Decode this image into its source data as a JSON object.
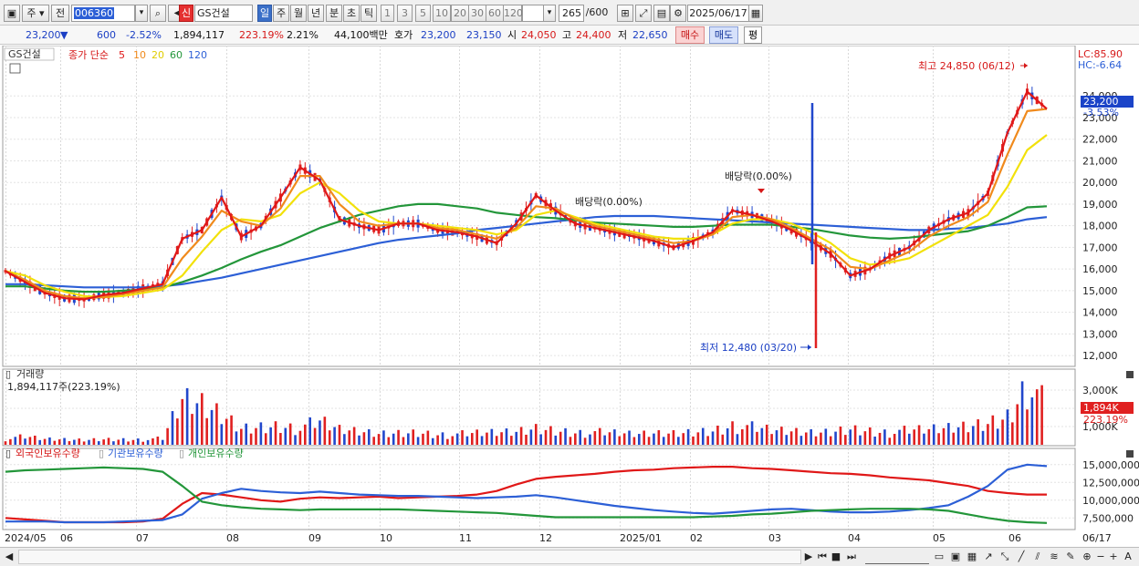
{
  "toolbar": {
    "period_unit": "주",
    "prev_label": "전",
    "stock_code": "006360",
    "new_badge": "신",
    "stock_name": "GS건설",
    "periods": [
      "일",
      "주",
      "월",
      "년",
      "분",
      "초",
      "틱"
    ],
    "minute_options": [
      "1",
      "3",
      "5",
      "10",
      "20",
      "30",
      "60",
      "120"
    ],
    "count_value": "265",
    "count_total": "/600",
    "date": "2025/06/17"
  },
  "quote": {
    "price": "23,200",
    "change_arrow": "▼",
    "change": "600",
    "change_pct": "-2.52%",
    "volume": "1,894,117",
    "volume_ratio": "223.19%",
    "turnover": "2.21%",
    "amount": "44,100백만",
    "hoga_label": "호가",
    "ask": "23,200",
    "bid": "23,150",
    "open_label": "시",
    "open": "24,050",
    "high_label": "고",
    "high": "24,400",
    "low_label": "저",
    "low": "22,650",
    "buy_label": "매수",
    "sell_label": "매도",
    "avg_label": "평"
  },
  "price_panel": {
    "name_tag": "GS건설",
    "ma_label": "종가 단순",
    "ma_periods": [
      "5",
      "10",
      "20",
      "60",
      "120"
    ],
    "ma_colors": [
      "#e01818",
      "#f08a1c",
      "#f2e10a",
      "#23963a",
      "#2c5fd6"
    ],
    "lc": "LC:85.90",
    "hc": "HC:-6.64",
    "high_annot": "최고 24,850 (06/12)",
    "low_annot": "최저 12,480 (03/20)",
    "div_annot_1": "배당락(0.00%)",
    "div_annot_2": "배당락(0.00%)",
    "current_price": "23,200",
    "current_pct": "-3.53%"
  },
  "volume_panel": {
    "title": "거래량",
    "value": "1,894,117주(223.19%)",
    "current_k": "1,894K",
    "current_pct": "223.19%"
  },
  "holdings_panel": {
    "labels": [
      "외국인보유수량",
      "기관보유수량",
      "개인보유수량"
    ],
    "colors": [
      "#e01818",
      "#2c5fd6",
      "#23963a"
    ]
  },
  "x_axis": {
    "ticks": [
      "2024/05",
      "06",
      "07",
      "08",
      "09",
      "10",
      "11",
      "12",
      "2025/01",
      "02",
      "03",
      "04",
      "05",
      "06"
    ],
    "last": "06/17"
  },
  "chart_data": [
    {
      "type": "line",
      "title": "GS건설",
      "ylabel": "",
      "ylim": [
        11500,
        25400
      ],
      "y_ticks": [
        "24,000",
        "23,000",
        "22,000",
        "21,000",
        "20,000",
        "19,000",
        "18,000",
        "17,000",
        "16,000",
        "15,000",
        "14,000",
        "13,000",
        "12,000"
      ],
      "x_dates": [
        "2024/05",
        "06",
        "07",
        "08",
        "09",
        "10",
        "11",
        "12",
        "2025/01",
        "02",
        "03",
        "04",
        "05",
        "06"
      ],
      "series": [
        {
          "name": "5",
          "color": "#e01818",
          "values": [
            15900,
            15400,
            14900,
            14650,
            14600,
            14800,
            14900,
            15100,
            15300,
            17400,
            17800,
            19300,
            17500,
            18000,
            19300,
            20700,
            20100,
            18300,
            18000,
            17800,
            18100,
            18100,
            17800,
            17700,
            17500,
            17200,
            18100,
            19400,
            18700,
            18100,
            17900,
            17700,
            17500,
            17300,
            17000,
            17300,
            17700,
            18700,
            18500,
            18200,
            17800,
            17300,
            16700,
            15700,
            16000,
            16600,
            17000,
            17800,
            18300,
            18600,
            19500,
            22300,
            24200,
            23400
          ]
        },
        {
          "name": "10",
          "color": "#f08a1c",
          "values": [
            15900,
            15500,
            15000,
            14750,
            14650,
            14700,
            14850,
            15000,
            15150,
            16500,
            17500,
            18700,
            18200,
            18000,
            18800,
            20300,
            20300,
            19000,
            18200,
            18000,
            18100,
            18100,
            17900,
            17800,
            17600,
            17400,
            17900,
            18900,
            18800,
            18300,
            18000,
            17800,
            17600,
            17400,
            17200,
            17300,
            17600,
            18400,
            18500,
            18300,
            17900,
            17400,
            16900,
            16100,
            16000,
            16400,
            16800,
            17500,
            18000,
            18400,
            19100,
            21300,
            23300,
            23400
          ]
        },
        {
          "name": "20",
          "color": "#f2e10a",
          "values": [
            15900,
            15700,
            15250,
            14950,
            14750,
            14700,
            14750,
            14900,
            15050,
            15700,
            16800,
            17800,
            18300,
            18200,
            18500,
            19500,
            20000,
            19500,
            18700,
            18200,
            18100,
            18100,
            18000,
            17900,
            17800,
            17600,
            17800,
            18500,
            18700,
            18400,
            18100,
            17900,
            17700,
            17500,
            17400,
            17400,
            17600,
            18100,
            18300,
            18300,
            18100,
            17700,
            17200,
            16500,
            16200,
            16300,
            16500,
            17000,
            17500,
            18000,
            18500,
            19800,
            21500,
            22200
          ]
        },
        {
          "name": "60",
          "color": "#23963a",
          "values": [
            15200,
            15200,
            15100,
            15000,
            14950,
            14950,
            15000,
            15050,
            15150,
            15400,
            15700,
            16050,
            16450,
            16800,
            17100,
            17500,
            17900,
            18200,
            18500,
            18700,
            18900,
            19000,
            19000,
            18900,
            18800,
            18600,
            18500,
            18400,
            18350,
            18250,
            18150,
            18100,
            18050,
            18000,
            17950,
            17950,
            18000,
            18050,
            18050,
            18050,
            17950,
            17850,
            17700,
            17550,
            17450,
            17400,
            17450,
            17550,
            17650,
            17750,
            18000,
            18400,
            18850,
            18900
          ]
        },
        {
          "name": "120",
          "color": "#2c5fd6",
          "values": [
            15300,
            15300,
            15250,
            15200,
            15150,
            15150,
            15150,
            15150,
            15200,
            15300,
            15450,
            15600,
            15800,
            16000,
            16200,
            16400,
            16600,
            16800,
            17000,
            17200,
            17350,
            17450,
            17550,
            17650,
            17800,
            17900,
            18000,
            18100,
            18200,
            18300,
            18400,
            18450,
            18450,
            18450,
            18400,
            18350,
            18300,
            18250,
            18200,
            18150,
            18100,
            18050,
            18000,
            17950,
            17900,
            17850,
            17800,
            17800,
            17850,
            17900,
            18000,
            18100,
            18300,
            18400
          ]
        }
      ]
    },
    {
      "type": "bar",
      "title": "거래량",
      "ylim": [
        0,
        3500000
      ],
      "y_ticks": [
        "3,000K",
        "2,000K",
        "1,000K"
      ],
      "values": [
        350,
        420,
        300,
        280,
        260,
        310,
        300,
        290,
        320,
        2300,
        2100,
        1600,
        900,
        1000,
        1100,
        900,
        1200,
        800,
        700,
        600,
        650,
        700,
        600,
        550,
        600,
        650,
        700,
        900,
        800,
        700,
        650,
        600,
        550,
        600,
        620,
        700,
        800,
        1100,
        900,
        750,
        700,
        650,
        700,
        900,
        800,
        700,
        750,
        800,
        900,
        1000,
        1200,
        1600,
        3400,
        1894
      ]
    },
    {
      "type": "line",
      "title": "보유수량",
      "ylim": [
        6000000,
        16000000
      ],
      "y_ticks": [
        "15,000,000",
        "12,500,000",
        "10,000,000",
        "7,500,000"
      ],
      "series": [
        {
          "name": "외국인보유수량",
          "color": "#e01818",
          "values": [
            7500000,
            7300000,
            7100000,
            6900000,
            6900000,
            6900000,
            6900000,
            7000000,
            7400000,
            9500000,
            11000000,
            10800000,
            10400000,
            10000000,
            9800000,
            10200000,
            10400000,
            10300000,
            10400000,
            10500000,
            10300000,
            10400000,
            10500000,
            10600000,
            10800000,
            11300000,
            12200000,
            13000000,
            13300000,
            13500000,
            13700000,
            14000000,
            14200000,
            14300000,
            14500000,
            14600000,
            14700000,
            14700000,
            14500000,
            14400000,
            14200000,
            14000000,
            13800000,
            13700000,
            13500000,
            13200000,
            13000000,
            12800000,
            12400000,
            12000000,
            11300000,
            11000000,
            10800000,
            10800000
          ]
        },
        {
          "name": "기관보유수량",
          "color": "#2c5fd6",
          "values": [
            7000000,
            7000000,
            7000000,
            6900000,
            6900000,
            6900000,
            7000000,
            7100000,
            7200000,
            8000000,
            10200000,
            11000000,
            11600000,
            11300000,
            11100000,
            11000000,
            11200000,
            11000000,
            10800000,
            10700000,
            10600000,
            10600000,
            10500000,
            10400000,
            10300000,
            10400000,
            10500000,
            10700000,
            10400000,
            10000000,
            9600000,
            9200000,
            8900000,
            8600000,
            8400000,
            8200000,
            8100000,
            8300000,
            8500000,
            8700000,
            8800000,
            8600000,
            8400000,
            8300000,
            8300000,
            8400000,
            8600000,
            8900000,
            9300000,
            10500000,
            12000000,
            14300000,
            15000000,
            14800000
          ]
        },
        {
          "name": "개인보유수량",
          "color": "#23963a",
          "values": [
            14000000,
            14200000,
            14300000,
            14400000,
            14500000,
            14600000,
            14500000,
            14400000,
            14000000,
            12000000,
            9800000,
            9300000,
            9000000,
            8800000,
            8700000,
            8600000,
            8700000,
            8700000,
            8700000,
            8700000,
            8700000,
            8600000,
            8500000,
            8400000,
            8300000,
            8200000,
            8000000,
            7800000,
            7600000,
            7600000,
            7600000,
            7600000,
            7600000,
            7600000,
            7600000,
            7600000,
            7700000,
            7800000,
            8000000,
            8100000,
            8300000,
            8500000,
            8600000,
            8700000,
            8800000,
            8800000,
            8800000,
            8700000,
            8500000,
            8000000,
            7500000,
            7100000,
            6900000,
            6800000
          ]
        }
      ]
    }
  ]
}
